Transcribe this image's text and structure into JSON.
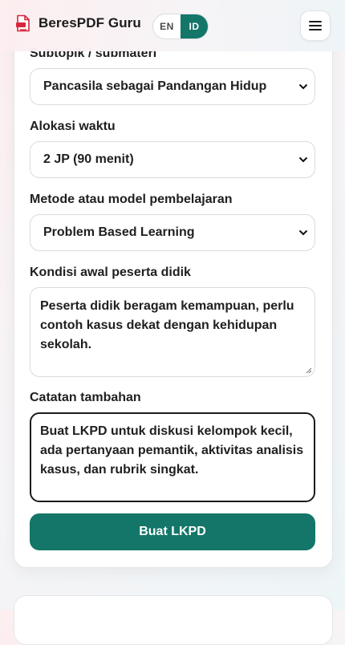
{
  "header": {
    "brand": "BeresPDF Guru",
    "lang_en": "EN",
    "lang_id": "ID",
    "active_lang": "ID"
  },
  "form": {
    "subtopic": {
      "label": "Subtopik / submateri",
      "value": "Pancasila sebagai Pandangan Hidup"
    },
    "duration": {
      "label": "Alokasi waktu",
      "value": "2 JP (90 menit)"
    },
    "method": {
      "label": "Metode atau model pembelajaran",
      "value": "Problem Based Learning"
    },
    "initial_condition": {
      "label": "Kondisi awal peserta didik",
      "value": "Peserta didik beragam kemampuan, perlu contoh kasus dekat dengan kehidupan sekolah."
    },
    "notes": {
      "label": "Catatan tambahan",
      "value": "Buat LKPD untuk diskusi kelompok kecil, ada pertanyaan pemantik, aktivitas analisis kasus, dan rubrik singkat."
    },
    "submit_label": "Buat LKPD"
  },
  "colors": {
    "accent": "#137668",
    "text": "#1f1f1f"
  },
  "icons": {
    "brand": "pdf-document-icon",
    "menu": "hamburger-menu-icon",
    "select": "chevron-down-icon"
  }
}
